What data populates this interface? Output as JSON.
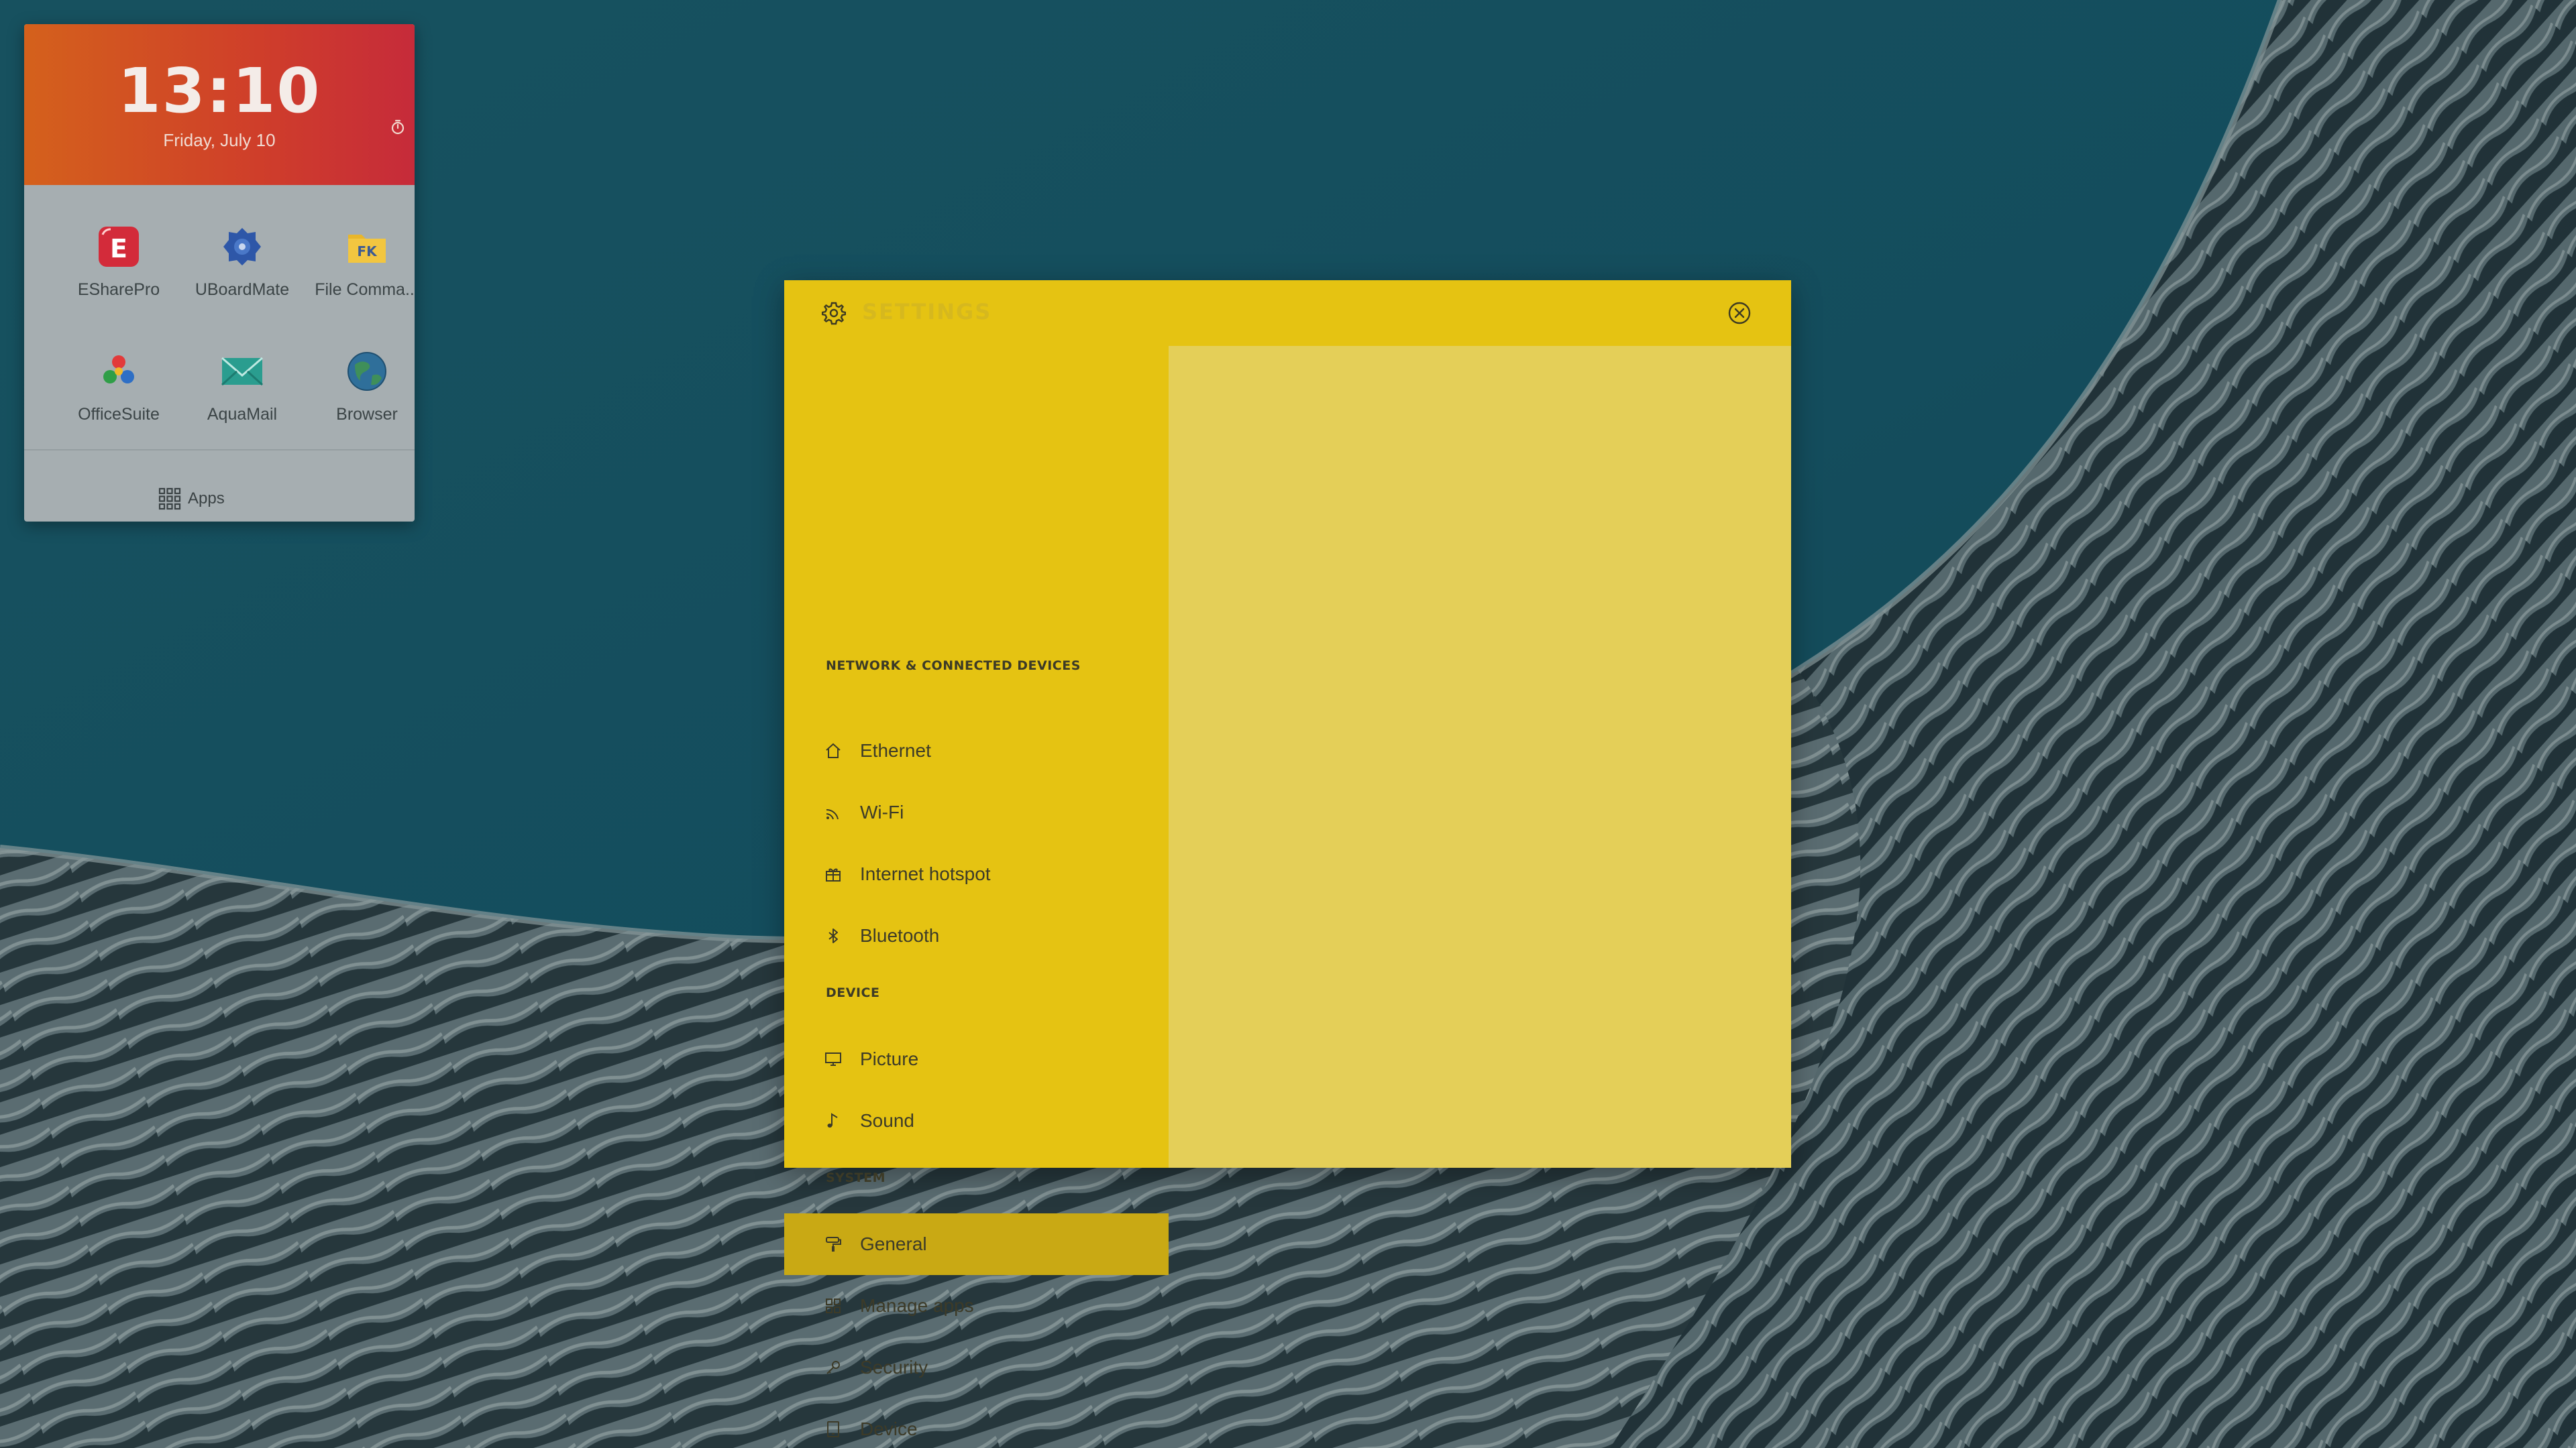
{
  "launcher": {
    "time": "13:10",
    "date": "Friday, July 10",
    "apps": [
      {
        "label": "ESharePro",
        "icon": "esharepro-icon"
      },
      {
        "label": "UBoardMate",
        "icon": "uboardmate-icon"
      },
      {
        "label": "File Comma...",
        "icon": "file-commander-icon"
      },
      {
        "label": "OfficeSuite",
        "icon": "officesuite-icon"
      },
      {
        "label": "AquaMail",
        "icon": "aquamail-icon"
      },
      {
        "label": "Browser",
        "icon": "browser-icon"
      }
    ],
    "apps_button_label": "Apps"
  },
  "settings": {
    "title": "SETTINGS",
    "sections": [
      {
        "header": "NETWORK & CONNECTED DEVICES",
        "items": [
          {
            "label": "Ethernet",
            "icon": "home-icon"
          },
          {
            "label": "Wi-Fi",
            "icon": "wifi-icon"
          },
          {
            "label": "Internet hotspot",
            "icon": "hotspot-icon"
          },
          {
            "label": "Bluetooth",
            "icon": "bluetooth-icon"
          }
        ]
      },
      {
        "header": "DEVICE",
        "items": [
          {
            "label": "Picture",
            "icon": "monitor-icon"
          },
          {
            "label": "Sound",
            "icon": "music-note-icon"
          }
        ]
      },
      {
        "header": "SYSTEM",
        "items": [
          {
            "label": "General",
            "icon": "paint-roller-icon",
            "selected": true
          },
          {
            "label": "Manage apps",
            "icon": "grid-icon"
          },
          {
            "label": "Security",
            "icon": "key-icon"
          },
          {
            "label": "Device",
            "icon": "tablet-icon"
          }
        ]
      }
    ]
  },
  "colors": {
    "window_yellow": "#e5c312",
    "content_yellow": "#e4cf58",
    "selected_item": "#c9a914",
    "clock_gradient_start": "#d4611c",
    "clock_gradient_end": "#c62b3a"
  }
}
